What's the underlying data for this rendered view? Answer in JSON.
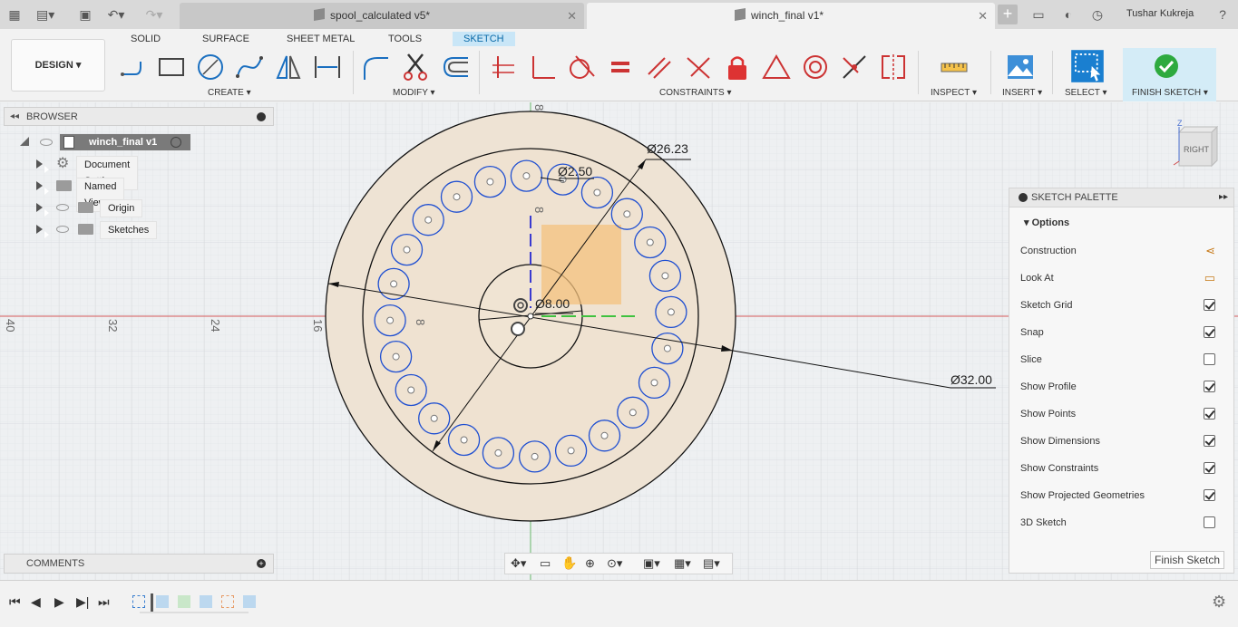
{
  "tabs": [
    {
      "title": "spool_calculated v5*",
      "active": false
    },
    {
      "title": "winch_final v1*",
      "active": true
    }
  ],
  "user": "Tushar Kukreja",
  "workspace": "DESIGN",
  "workspace_tabs": [
    "SOLID",
    "SURFACE",
    "SHEET METAL",
    "TOOLS",
    "SKETCH"
  ],
  "toolbar_groups": {
    "create": "CREATE",
    "modify": "MODIFY",
    "constraints": "CONSTRAINTS",
    "inspect": "INSPECT",
    "insert": "INSERT",
    "select": "SELECT",
    "finish": "FINISH SKETCH"
  },
  "browser": {
    "title": "BROWSER",
    "root": "winch_final v1",
    "items": [
      "Document Settings",
      "Named Views",
      "Origin",
      "Sketches"
    ]
  },
  "palette": {
    "title": "SKETCH PALETTE",
    "section": "Options",
    "rows": [
      {
        "label": "Construction",
        "type": "icon"
      },
      {
        "label": "Look At",
        "type": "icon"
      },
      {
        "label": "Sketch Grid",
        "checked": true
      },
      {
        "label": "Snap",
        "checked": true
      },
      {
        "label": "Slice",
        "checked": false
      },
      {
        "label": "Show Profile",
        "checked": true
      },
      {
        "label": "Show Points",
        "checked": true
      },
      {
        "label": "Show Dimensions",
        "checked": true
      },
      {
        "label": "Show Constraints",
        "checked": true
      },
      {
        "label": "Show Projected Geometries",
        "checked": true
      },
      {
        "label": "3D Sketch",
        "checked": false
      }
    ],
    "finish_button": "Finish Sketch"
  },
  "comments": "COMMENTS",
  "viewcube": {
    "face": "RIGHT",
    "axis": "Z"
  },
  "sketch": {
    "dimensions": [
      "Ø26.23",
      "Ø2.50",
      "Ø8.00",
      "Ø32.00"
    ],
    "ruler_h": [
      "40",
      "32",
      "24",
      "16",
      "8"
    ],
    "ruler_v": [
      "8",
      "8"
    ]
  }
}
